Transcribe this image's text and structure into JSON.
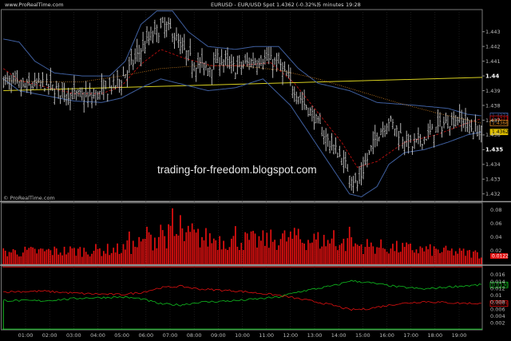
{
  "header": {
    "site": "www.ProRealTime.com",
    "title": "EURUSD - EUR/USD Spot",
    "quote": "1.4362 (-0.32%)",
    "interval": "5 minutes",
    "time": "19:28"
  },
  "watermark": "trading-for-freedom.blogspot.com",
  "copyright": "© ProRealTime.com",
  "colors": {
    "background": "#000000",
    "candle": "#c8c8c8",
    "bollinger": "#3f5f9f",
    "dotted_ma": "#d08020",
    "dashed_ma": "#cc1111",
    "trendline": "#d8d020",
    "volume": "#e01010",
    "osc_green": "#10c020",
    "osc_red": "#e01010",
    "grid": "#333333",
    "price_tag_bg": "#e0c000"
  },
  "chart_data": [
    {
      "type": "candlestick",
      "ylim": [
        1.4315,
        1.4445
      ],
      "y_ticks": [
        "1.443",
        "1.442",
        "1.441",
        "1.44",
        "1.439",
        "1.438",
        "1.437",
        "1.436",
        "1.435",
        "1.434",
        "1.433",
        "1.432"
      ],
      "x_ticks": [
        "01:00",
        "02:00",
        "03:00",
        "04:00",
        "05:00",
        "06:00",
        "07:00",
        "08:00",
        "09:00",
        "10:00",
        "11:00",
        "12:00",
        "13:00",
        "14:00",
        "15:00",
        "16:00",
        "17:00",
        "18:00",
        "19:00"
      ],
      "price_labels": [
        {
          "value": 1.4373,
          "text": "1.4373",
          "color": "#3f5f9f"
        },
        {
          "value": 1.4371,
          "text": "1.4371",
          "color": "#cc1111"
        },
        {
          "value": 1.4368,
          "text": "1.4368",
          "color": "#d08020"
        },
        {
          "value": 1.4362,
          "text": "1.4362",
          "color": "#e0c000"
        }
      ],
      "anchors": {
        "close": [
          [
            0,
            1.4397
          ],
          [
            10,
            1.4392
          ],
          [
            20,
            1.4395
          ],
          [
            28,
            1.439
          ],
          [
            36,
            1.4387
          ],
          [
            44,
            1.4385
          ],
          [
            52,
            1.439
          ],
          [
            58,
            1.4395
          ],
          [
            64,
            1.4405
          ],
          [
            70,
            1.4418
          ],
          [
            76,
            1.4428
          ],
          [
            82,
            1.4434
          ],
          [
            86,
            1.443
          ],
          [
            90,
            1.442
          ],
          [
            96,
            1.441
          ],
          [
            104,
            1.4405
          ],
          [
            110,
            1.4412
          ],
          [
            118,
            1.4405
          ],
          [
            126,
            1.441
          ],
          [
            132,
            1.4412
          ],
          [
            140,
            1.4408
          ],
          [
            146,
            1.4395
          ],
          [
            152,
            1.4383
          ],
          [
            158,
            1.4372
          ],
          [
            164,
            1.4358
          ],
          [
            170,
            1.4348
          ],
          [
            176,
            1.4335
          ],
          [
            180,
            1.4325
          ],
          [
            184,
            1.434
          ],
          [
            190,
            1.436
          ],
          [
            196,
            1.437
          ],
          [
            202,
            1.436
          ],
          [
            208,
            1.4352
          ],
          [
            214,
            1.4358
          ],
          [
            220,
            1.4364
          ],
          [
            226,
            1.4369
          ],
          [
            232,
            1.4372
          ],
          [
            238,
            1.4365
          ],
          [
            243,
            1.4362
          ]
        ],
        "bb_upper": [
          [
            0,
            1.4425
          ],
          [
            8,
            1.4423
          ],
          [
            16,
            1.441
          ],
          [
            26,
            1.4402
          ],
          [
            40,
            1.44
          ],
          [
            54,
            1.44
          ],
          [
            62,
            1.441
          ],
          [
            70,
            1.4435
          ],
          [
            78,
            1.4444
          ],
          [
            86,
            1.4444
          ],
          [
            94,
            1.443
          ],
          [
            104,
            1.442
          ],
          [
            118,
            1.4418
          ],
          [
            128,
            1.442
          ],
          [
            140,
            1.442
          ],
          [
            150,
            1.4405
          ],
          [
            160,
            1.4395
          ],
          [
            176,
            1.439
          ],
          [
            190,
            1.4382
          ],
          [
            210,
            1.438
          ],
          [
            226,
            1.4378
          ],
          [
            236,
            1.4374
          ],
          [
            243,
            1.4373
          ]
        ],
        "bb_lower": [
          [
            0,
            1.4398
          ],
          [
            8,
            1.439
          ],
          [
            20,
            1.4387
          ],
          [
            36,
            1.4383
          ],
          [
            50,
            1.4382
          ],
          [
            60,
            1.4385
          ],
          [
            70,
            1.4392
          ],
          [
            80,
            1.4398
          ],
          [
            92,
            1.4394
          ],
          [
            104,
            1.439
          ],
          [
            118,
            1.4392
          ],
          [
            132,
            1.4398
          ],
          [
            146,
            1.438
          ],
          [
            156,
            1.436
          ],
          [
            166,
            1.434
          ],
          [
            176,
            1.432
          ],
          [
            182,
            1.4318
          ],
          [
            190,
            1.4325
          ],
          [
            196,
            1.434
          ],
          [
            204,
            1.4348
          ],
          [
            214,
            1.435
          ],
          [
            226,
            1.4355
          ],
          [
            236,
            1.436
          ],
          [
            243,
            1.4362
          ]
        ],
        "ma_dotted": [
          [
            0,
            1.4397
          ],
          [
            20,
            1.4396
          ],
          [
            40,
            1.4396
          ],
          [
            60,
            1.44
          ],
          [
            80,
            1.4405
          ],
          [
            100,
            1.4407
          ],
          [
            120,
            1.4407
          ],
          [
            140,
            1.4404
          ],
          [
            160,
            1.4398
          ],
          [
            180,
            1.439
          ],
          [
            200,
            1.4382
          ],
          [
            220,
            1.4375
          ],
          [
            243,
            1.4368
          ]
        ],
        "ma_dashed": [
          [
            0,
            1.4405
          ],
          [
            8,
            1.4397
          ],
          [
            20,
            1.4393
          ],
          [
            36,
            1.4388
          ],
          [
            50,
            1.4388
          ],
          [
            60,
            1.4393
          ],
          [
            70,
            1.4408
          ],
          [
            80,
            1.4418
          ],
          [
            92,
            1.4412
          ],
          [
            106,
            1.4407
          ],
          [
            120,
            1.4407
          ],
          [
            136,
            1.4409
          ],
          [
            148,
            1.4395
          ],
          [
            160,
            1.4375
          ],
          [
            172,
            1.4355
          ],
          [
            180,
            1.4338
          ],
          [
            190,
            1.4342
          ],
          [
            204,
            1.4355
          ],
          [
            220,
            1.436
          ],
          [
            236,
            1.4368
          ],
          [
            243,
            1.4371
          ]
        ],
        "trendline": [
          [
            0,
            1.439
          ],
          [
            243,
            1.4399
          ]
        ]
      }
    },
    {
      "type": "bar",
      "name": "volume",
      "ylim": [
        0,
        0.09
      ],
      "y_ticks": [
        "0.08",
        "0.06",
        "0.04",
        "0.02"
      ],
      "profile": [
        [
          0,
          0.018
        ],
        [
          40,
          0.02
        ],
        [
          60,
          0.022
        ],
        [
          70,
          0.03
        ],
        [
          80,
          0.042
        ],
        [
          96,
          0.04
        ],
        [
          110,
          0.036
        ],
        [
          130,
          0.034
        ],
        [
          145,
          0.038
        ],
        [
          160,
          0.035
        ],
        [
          180,
          0.028
        ],
        [
          200,
          0.024
        ],
        [
          220,
          0.02
        ],
        [
          243,
          0.015
        ]
      ],
      "spikes": [
        [
          86,
          0.082
        ],
        [
          90,
          0.072
        ],
        [
          96,
          0.06
        ],
        [
          73,
          0.055
        ],
        [
          80,
          0.058
        ],
        [
          118,
          0.056
        ],
        [
          150,
          0.052
        ],
        [
          168,
          0.05
        ],
        [
          176,
          0.055
        ],
        [
          64,
          0.048
        ]
      ],
      "last_label": {
        "value": 0.0122,
        "text": "0.0122"
      }
    },
    {
      "type": "line",
      "name": "oscillator",
      "ylim": [
        0,
        0.0185
      ],
      "y_ticks": [
        "0.016",
        "0.014",
        "0.012",
        "0.01",
        "0.008",
        "0.006",
        "0.004",
        "0.002"
      ],
      "anchors": {
        "green": [
          [
            0,
            0.0085
          ],
          [
            20,
            0.0084
          ],
          [
            40,
            0.0092
          ],
          [
            60,
            0.0095
          ],
          [
            70,
            0.009
          ],
          [
            80,
            0.0075
          ],
          [
            90,
            0.0072
          ],
          [
            100,
            0.008
          ],
          [
            120,
            0.0085
          ],
          [
            140,
            0.0095
          ],
          [
            150,
            0.011
          ],
          [
            160,
            0.012
          ],
          [
            170,
            0.013
          ],
          [
            176,
            0.0142
          ],
          [
            184,
            0.0138
          ],
          [
            200,
            0.0125
          ],
          [
            214,
            0.0118
          ],
          [
            228,
            0.0125
          ],
          [
            243,
            0.013
          ]
        ],
        "red": [
          [
            0,
            0.011
          ],
          [
            20,
            0.0112
          ],
          [
            40,
            0.0105
          ],
          [
            60,
            0.0102
          ],
          [
            70,
            0.0108
          ],
          [
            80,
            0.0122
          ],
          [
            90,
            0.0126
          ],
          [
            100,
            0.0118
          ],
          [
            120,
            0.0112
          ],
          [
            140,
            0.01
          ],
          [
            150,
            0.009
          ],
          [
            160,
            0.008
          ],
          [
            170,
            0.0068
          ],
          [
            176,
            0.0058
          ],
          [
            184,
            0.006
          ],
          [
            200,
            0.0075
          ],
          [
            214,
            0.0082
          ],
          [
            228,
            0.0078
          ],
          [
            243,
            0.0076
          ]
        ]
      },
      "labels": [
        {
          "value": 0.013,
          "text": "0.0130",
          "color": "#10c020"
        },
        {
          "value": 0.0076,
          "text": "0.0076",
          "color": "#e01010"
        }
      ]
    }
  ]
}
